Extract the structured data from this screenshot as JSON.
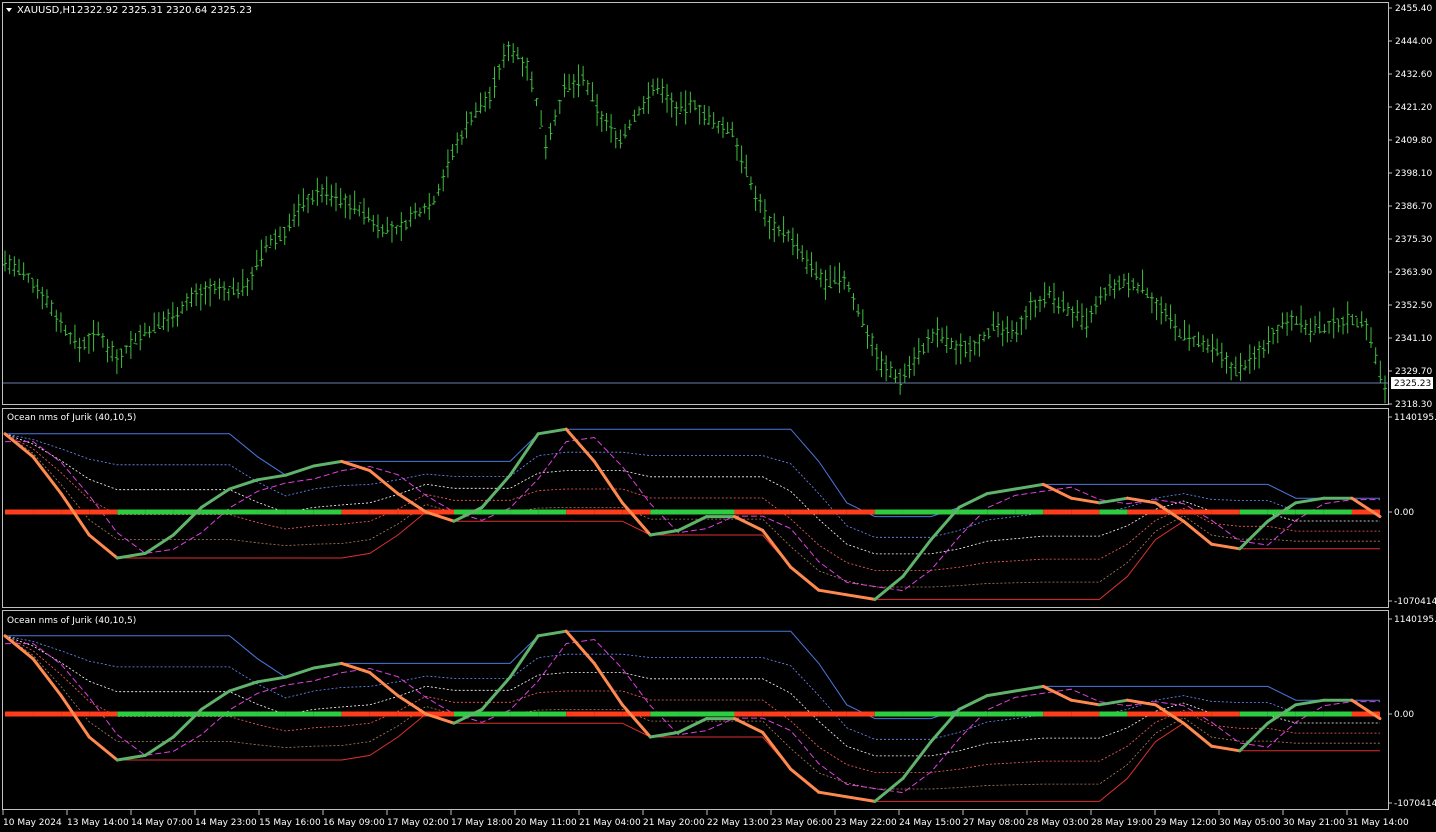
{
  "main": {
    "symbol": "XAUUSD,H1",
    "ohlc": "2322.92 2325.31 2320.64 2325.23",
    "price_labels": [
      "2455.40",
      "2444.00",
      "2432.60",
      "2421.20",
      "2409.80",
      "2398.10",
      "2386.70",
      "2375.30",
      "2363.90",
      "2352.50",
      "2341.10",
      "2329.70",
      "2318.30"
    ],
    "current_price": "2325.23",
    "colors": {
      "bars": "#3dbf3d",
      "bid_line": "#6a7fa8",
      "frame": "#c0c0c0"
    }
  },
  "indicator1": {
    "title": "Ocean nms of Jurik (40,10,5)",
    "levels": [
      "1140195.7",
      "0.00",
      "-1070414."
    ]
  },
  "indicator2": {
    "title": "Ocean nms of Jurik (40,10,5)",
    "levels": [
      "1140195.7",
      "0.00",
      "-1070414."
    ]
  },
  "time_axis": [
    "10 May 2024",
    "13 May 14:00",
    "14 May 07:00",
    "14 May 23:00",
    "15 May 16:00",
    "16 May 09:00",
    "17 May 02:00",
    "17 May 18:00",
    "20 May 11:00",
    "21 May 04:00",
    "21 May 20:00",
    "22 May 13:00",
    "23 May 06:00",
    "23 May 22:00",
    "24 May 15:00",
    "27 May 08:00",
    "28 May 03:00",
    "28 May 19:00",
    "29 May 12:00",
    "30 May 05:00",
    "30 May 21:00",
    "31 May 14:00"
  ],
  "chart_data": [
    {
      "type": "candlestick-bars",
      "series": [
        {
          "name": "XAUUSD,H1",
          "values": [
            2368,
            2363,
            2357,
            2346,
            2338,
            2343,
            2334,
            2341,
            2345,
            2349,
            2355,
            2358,
            2357,
            2360,
            2373,
            2378,
            2388,
            2392,
            2389,
            2386,
            2380,
            2378,
            2384,
            2389,
            2405,
            2418,
            2425,
            2442,
            2436,
            2409,
            2427,
            2431,
            2417,
            2410,
            2420,
            2429,
            2420,
            2422,
            2415,
            2413,
            2394,
            2381,
            2377,
            2367,
            2360,
            2362,
            2347,
            2332,
            2327,
            2336,
            2343,
            2337,
            2339,
            2345,
            2342,
            2352,
            2356,
            2351,
            2346,
            2357,
            2360,
            2359,
            2351,
            2343,
            2339,
            2336,
            2330,
            2334,
            2343,
            2349,
            2344,
            2345,
            2348,
            2346,
            2323
          ]
        }
      ],
      "ylim": [
        2318.3,
        2455.4
      ]
    },
    {
      "type": "line",
      "title": "Ocean nms of Jurik (40,10,5)",
      "series": [
        {
          "name": "Ocean nms of Jurik",
          "values": [
            0.85,
            0.6,
            0.2,
            -0.25,
            -0.5,
            -0.45,
            -0.25,
            0.05,
            0.25,
            0.35,
            0.4,
            0.5,
            0.55,
            0.45,
            0.2,
            0.0,
            -0.1,
            0.05,
            0.4,
            0.85,
            0.9,
            0.55,
            0.1,
            -0.25,
            -0.2,
            -0.05,
            -0.05,
            -0.2,
            -0.6,
            -0.85,
            -0.9,
            -0.95,
            -0.7,
            -0.3,
            0.05,
            0.2,
            0.25,
            0.3,
            0.15,
            0.1,
            0.15,
            0.1,
            -0.1,
            -0.35,
            -0.4,
            -0.1,
            0.1,
            0.15,
            0.15,
            -0.05
          ]
        }
      ],
      "ylim": [
        -1070414,
        1140195.7
      ]
    }
  ]
}
